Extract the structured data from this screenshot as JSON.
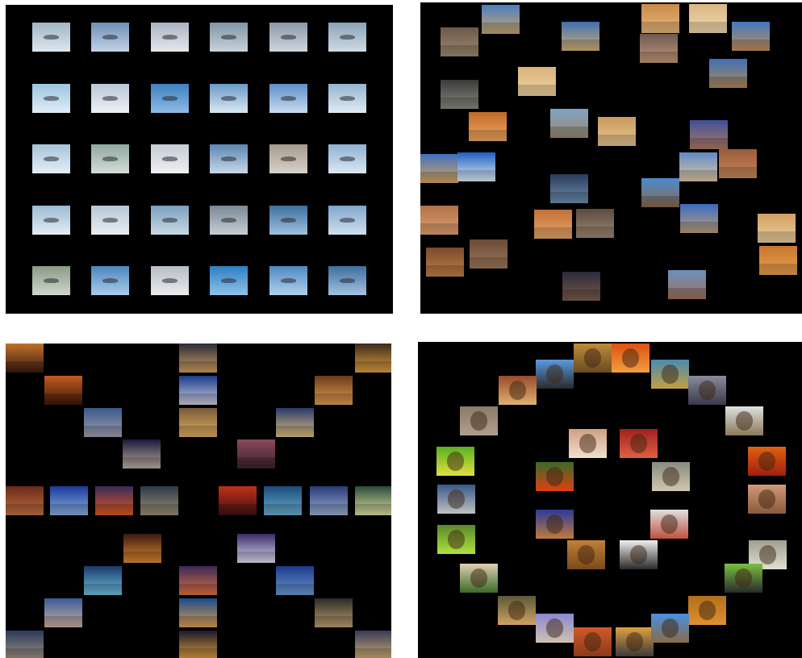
{
  "panels": [
    {
      "id": "panel-aircraft",
      "theme": "aircraft",
      "tiles": [
        {
          "c1": "#9fb6c6",
          "c2": "#dfe7ee"
        },
        {
          "c1": "#6f8fb6",
          "c2": "#c3d3e6"
        },
        {
          "c1": "#aab3c2",
          "c2": "#e6e8ec"
        },
        {
          "c1": "#7f95a6",
          "c2": "#c9d3da"
        },
        {
          "c1": "#8c99a8",
          "c2": "#cfd6dd"
        },
        {
          "c1": "#8aa3b8",
          "c2": "#d0dbe4"
        },
        {
          "c1": "#9ec4e0",
          "c2": "#e0edf6"
        },
        {
          "c1": "#b9c6d9",
          "c2": "#eef1f6"
        },
        {
          "c1": "#3f7fbf",
          "c2": "#8dbbe6"
        },
        {
          "c1": "#6a9cc6",
          "c2": "#d9e8f2"
        },
        {
          "c1": "#5d8fc8",
          "c2": "#c9dcef"
        },
        {
          "c1": "#94b5cf",
          "c2": "#e1ebf2"
        },
        {
          "c1": "#a8c3db",
          "c2": "#e5eef5"
        },
        {
          "c1": "#8fa99f",
          "c2": "#d4dcd6"
        },
        {
          "c1": "#c4cbd4",
          "c2": "#eef0f3"
        },
        {
          "c1": "#5c86b0",
          "c2": "#c7d8e8"
        },
        {
          "c1": "#a69a8e",
          "c2": "#d8d1c8"
        },
        {
          "c1": "#8fb1d3",
          "c2": "#dbe7f2"
        },
        {
          "c1": "#9bbbd4",
          "c2": "#e3edf4"
        },
        {
          "c1": "#b8c7d4",
          "c2": "#e9eef2"
        },
        {
          "c1": "#7b9fbd",
          "c2": "#c9d9e5"
        },
        {
          "c1": "#7a8896",
          "c2": "#c6ced5"
        },
        {
          "c1": "#3e6f9e",
          "c2": "#9fc1de"
        },
        {
          "c1": "#7fa7cc",
          "c2": "#d0e0ee"
        },
        {
          "c1": "#8a9b86",
          "c2": "#cfd6cb"
        },
        {
          "c1": "#4d86bf",
          "c2": "#a9cbe8"
        },
        {
          "c1": "#b5bcc4",
          "c2": "#ebedef"
        },
        {
          "c1": "#2d7fc4",
          "c2": "#8fc3ea"
        },
        {
          "c1": "#4f89c2",
          "c2": "#b2d1ec"
        },
        {
          "c1": "#3c6e9e",
          "c2": "#a3c3e0"
        }
      ]
    },
    {
      "id": "panel-deserts",
      "theme": "deserts",
      "tiles": [
        {
          "c1": "#4b7fbf",
          "c2": "#c9a66b"
        },
        {
          "c1": "#6a5a4a",
          "c2": "#a08870"
        },
        {
          "c1": "#3d6fb0",
          "c2": "#d6b070"
        },
        {
          "c1": "#c98a4a",
          "c2": "#e6b87a"
        },
        {
          "c1": "#d9b683",
          "c2": "#f0d9b0"
        },
        {
          "c1": "#3c79c0",
          "c2": "#c98f55"
        },
        {
          "c1": "#6a5a52",
          "c2": "#c79a7a"
        },
        {
          "c1": "#3f6fb5",
          "c2": "#b08a58"
        },
        {
          "c1": "#3a3a3a",
          "c2": "#8a8a80"
        },
        {
          "c1": "#d9b27a",
          "c2": "#f0d2a0"
        },
        {
          "c1": "#c06a2a",
          "c2": "#f0a860"
        },
        {
          "c1": "#7fa2c6",
          "c2": "#9a8a70"
        },
        {
          "c1": "#c99a5a",
          "c2": "#e6c690"
        },
        {
          "c1": "#3f4f9a",
          "c2": "#b07a60"
        },
        {
          "c1": "#3f70c0",
          "c2": "#d9a45a"
        },
        {
          "c1": "#1f5fc0",
          "c2": "#e6eef6"
        },
        {
          "c1": "#2a3a5a",
          "c2": "#6f8fb0"
        },
        {
          "c1": "#5f89c6",
          "c2": "#e0c8a0"
        },
        {
          "c1": "#9a5a3a",
          "c2": "#c68a5a"
        },
        {
          "c1": "#b0704a",
          "c2": "#e0a070"
        },
        {
          "c1": "#4a8ad0",
          "c2": "#8a6a4a"
        },
        {
          "c1": "#c2703a",
          "c2": "#e6a66a"
        },
        {
          "c1": "#5a4a40",
          "c2": "#a08a70"
        },
        {
          "c1": "#3a6ac0",
          "c2": "#c0a07a"
        },
        {
          "c1": "#d2a060",
          "c2": "#ead0a0"
        },
        {
          "c1": "#7a4a2a",
          "c2": "#c0804a"
        },
        {
          "c1": "#6a4a38",
          "c2": "#a0785a"
        },
        {
          "c1": "#c9762e",
          "c2": "#e8a04e"
        },
        {
          "c1": "#2a2a3a",
          "c2": "#7a5a4a"
        },
        {
          "c1": "#6a90c0",
          "c2": "#a0705a"
        }
      ]
    },
    {
      "id": "panel-cities",
      "theme": "cities at night",
      "tiles": [
        {
          "c1": "#c0702a",
          "c2": "#3a1a10"
        },
        {
          "c1": "#2a2a3a",
          "c2": "#d0a060"
        },
        {
          "c1": "#3a2a1a",
          "c2": "#e0a040"
        },
        {
          "c1": "#c05a20",
          "c2": "#401808"
        },
        {
          "c1": "#1a3a8a",
          "c2": "#d0d0e0"
        },
        {
          "c1": "#6a3a1a",
          "c2": "#e0a050"
        },
        {
          "c1": "#3a5a8a",
          "c2": "#a0a0b0"
        },
        {
          "c1": "#7a5a3a",
          "c2": "#e0b060"
        },
        {
          "c1": "#2a3a6a",
          "c2": "#e0c080"
        },
        {
          "c1": "#1a1a3a",
          "c2": "#c0b0a0"
        },
        {
          "c1": "#8a4a5a",
          "c2": "#3a2030"
        },
        {
          "c1": "#6a2a1a",
          "c2": "#c07040"
        },
        {
          "c1": "#1a3a9a",
          "c2": "#8ab0e0"
        },
        {
          "c1": "#3a2a5a",
          "c2": "#e05a20"
        },
        {
          "c1": "#2a3a4a",
          "c2": "#a09070"
        },
        {
          "c1": "#c0301a",
          "c2": "#401010"
        },
        {
          "c1": "#1a4a7a",
          "c2": "#6ab0d0"
        },
        {
          "c1": "#2a3a7a",
          "c2": "#9ab0d0"
        },
        {
          "c1": "#2a4a3a",
          "c2": "#e0e0a0"
        },
        {
          "c1": "#3a1a10",
          "c2": "#e08a30"
        },
        {
          "c1": "#3a2a6a",
          "c2": "#e0e0f0"
        },
        {
          "c1": "#1a3a6a",
          "c2": "#70c0e0"
        },
        {
          "c1": "#3a2a5a",
          "c2": "#e07040"
        },
        {
          "c1": "#1a3a8a",
          "c2": "#6a9ad0"
        },
        {
          "c1": "#3a5a9a",
          "c2": "#d0b0a0"
        },
        {
          "c1": "#1a4a8a",
          "c2": "#e0a050"
        },
        {
          "c1": "#2a2a2a",
          "c2": "#c0a070"
        },
        {
          "c1": "#2a3a5a",
          "c2": "#a09080"
        },
        {
          "c1": "#1a1a2a",
          "c2": "#e0a040"
        },
        {
          "c1": "#3a3a5a",
          "c2": "#d0b070"
        }
      ]
    },
    {
      "id": "panel-animals",
      "theme": "animals",
      "tiles": [
        {
          "c1": "#c08a3a",
          "c2": "#6a4a20"
        },
        {
          "c1": "#e05010",
          "c2": "#f0a040"
        },
        {
          "c1": "#5a9ae0",
          "c2": "#2a2a2a"
        },
        {
          "c1": "#4a8ab0",
          "c2": "#c0a040"
        },
        {
          "c1": "#9a4a2a",
          "c2": "#e0b070"
        },
        {
          "c1": "#8a8a9a",
          "c2": "#3a3a4a"
        },
        {
          "c1": "#8a7a6a",
          "c2": "#b0a090"
        },
        {
          "c1": "#e0e0e0",
          "c2": "#8a7a5a"
        },
        {
          "c1": "#d0a080",
          "c2": "#f0e0d0"
        },
        {
          "c1": "#a02020",
          "c2": "#e06040"
        },
        {
          "c1": "#5ab020",
          "c2": "#e0e040"
        },
        {
          "c1": "#e06010",
          "c2": "#a02010"
        },
        {
          "c1": "#3a6a2a",
          "c2": "#e04010"
        },
        {
          "c1": "#8a8a80",
          "c2": "#d0c8b0"
        },
        {
          "c1": "#3a5a8a",
          "c2": "#c0c0c0"
        },
        {
          "c1": "#d09a7a",
          "c2": "#8a5a3a"
        },
        {
          "c1": "#e0e0e0",
          "c2": "#c05040"
        },
        {
          "c1": "#5a8a2a",
          "c2": "#b0e040"
        },
        {
          "c1": "#2a3a9a",
          "c2": "#c07a3a"
        },
        {
          "c1": "#c0803a",
          "c2": "#7a4a1a"
        },
        {
          "c1": "#f0f0f0",
          "c2": "#2a2a2a"
        },
        {
          "c1": "#a0a090",
          "c2": "#e0e0d0"
        },
        {
          "c1": "#e0d0b0",
          "c2": "#3a6a2a"
        },
        {
          "c1": "#7ac040",
          "c2": "#2a2a2a"
        },
        {
          "c1": "#b0701a",
          "c2": "#e09030"
        },
        {
          "c1": "#5a5a3a",
          "c2": "#d0a060"
        },
        {
          "c1": "#8a8ad0",
          "c2": "#d0c0b0"
        },
        {
          "c1": "#e0a040",
          "c2": "#3a3a3a"
        },
        {
          "c1": "#d05a2a",
          "c2": "#8a3a1a"
        },
        {
          "c1": "#4a90e0",
          "c2": "#8a6a4a"
        }
      ]
    }
  ]
}
